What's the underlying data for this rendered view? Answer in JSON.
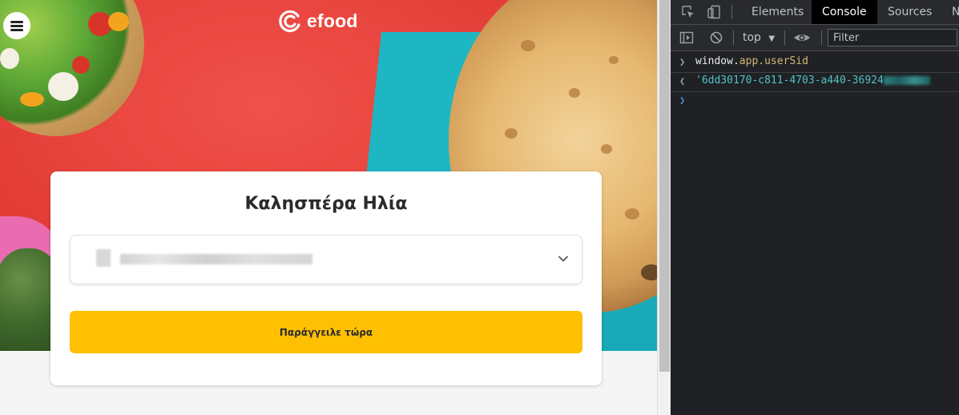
{
  "site": {
    "logo_text": "efood",
    "greeting": "Καλησπέρα Ηλία",
    "order_button": "Παράγγειλε τώρα",
    "colors": {
      "brand_red": "#e8453c",
      "accent_yellow": "#ffc003",
      "teal": "#1fb6c4"
    },
    "icons": {
      "menu": "hamburger-menu-icon",
      "logo": "efood-logo-icon",
      "dropdown": "chevron-down-icon"
    }
  },
  "devtools": {
    "tabs": [
      {
        "label": "Elements",
        "active": false
      },
      {
        "label": "Console",
        "active": true
      },
      {
        "label": "Sources",
        "active": false
      },
      {
        "label": "N",
        "active": false
      }
    ],
    "context": "top",
    "filter_placeholder": "Filter",
    "console": {
      "command_object": "window.",
      "command_property": "app.userSid",
      "result_prefix": "'6dd30170-c811-4703-a440-36924"
    },
    "colors": {
      "background": "#202124",
      "active_tab": "#000000",
      "string_result": "#4fc3c8"
    }
  }
}
